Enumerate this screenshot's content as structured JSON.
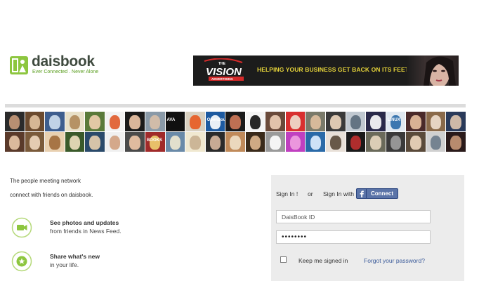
{
  "brand": {
    "name": "daisbook",
    "tagline": "Ever Connected . Never Alone",
    "accent": "#8dc63f"
  },
  "banner": {
    "logo_word": "VISION",
    "logo_small_top": "THE",
    "logo_small_bottom": "ADVERTISING",
    "slogan": "HELPING YOUR BUSINESS GET BACK ON ITS FEET",
    "bg_color": "#1c1c1c",
    "text_color": "#e6d43a"
  },
  "collage": {
    "labels": [
      "AVA",
      "OpenSource",
      "LINUX",
      "BOOKS"
    ]
  },
  "intro": {
    "headline": "The people meeting network",
    "subline": "connect with friends on daisbook."
  },
  "features": [
    {
      "icon": "video-camera-icon",
      "title": "See photos and updates",
      "subtitle": "from friends in News Feed."
    },
    {
      "icon": "star-icon",
      "title": "Share what's new",
      "subtitle": "in your life."
    }
  ],
  "login": {
    "sign_in_label": "Sign In !",
    "or_label": "or",
    "sign_in_with_label": "Sign In with",
    "connect_label": "Connect",
    "id_placeholder": "DaisBook ID",
    "password_value": "••••••••",
    "keep_signed_in": "Keep me signed in",
    "forgot_password": "Forgot your password?",
    "panel_color": "#ececec",
    "link_color": "#3b5b9a",
    "facebook_color": "#5b74a8"
  }
}
